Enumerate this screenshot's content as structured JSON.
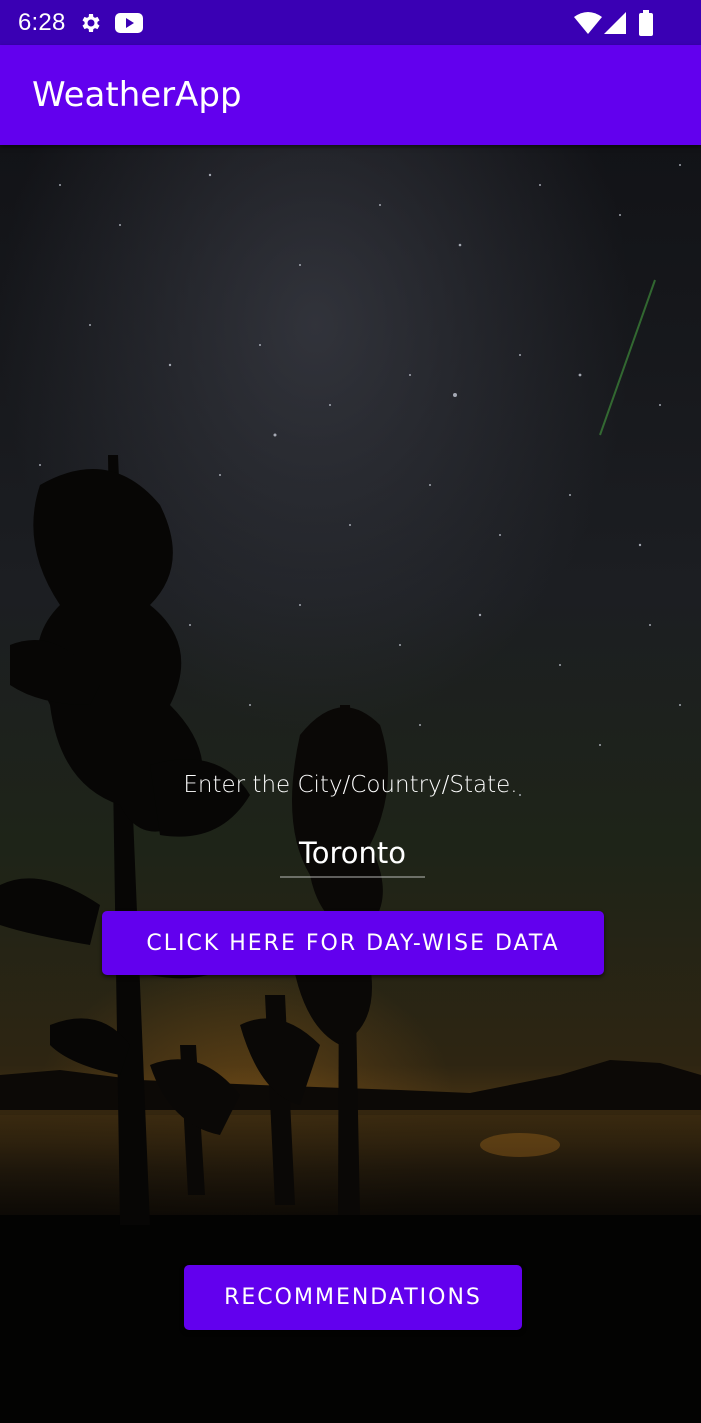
{
  "status_bar": {
    "time": "6:28",
    "left_icons": [
      "gear-icon",
      "youtube-icon"
    ],
    "right_icons": [
      "wifi-icon",
      "signal-icon",
      "battery-icon"
    ]
  },
  "app_bar": {
    "title": "WeatherApp"
  },
  "main": {
    "prompt": "Enter the City/Country/State.",
    "city_input": {
      "value": "Toronto"
    },
    "day_wise_button": "CLICK HERE FOR DAY-WISE DATA",
    "recommendations_button": "RECOMMENDATIONS",
    "background_image": "night-sky-trees-lake"
  },
  "colors": {
    "primary": "#6200ee",
    "status_bar": "#3a00b4",
    "text": "#ffffff"
  }
}
